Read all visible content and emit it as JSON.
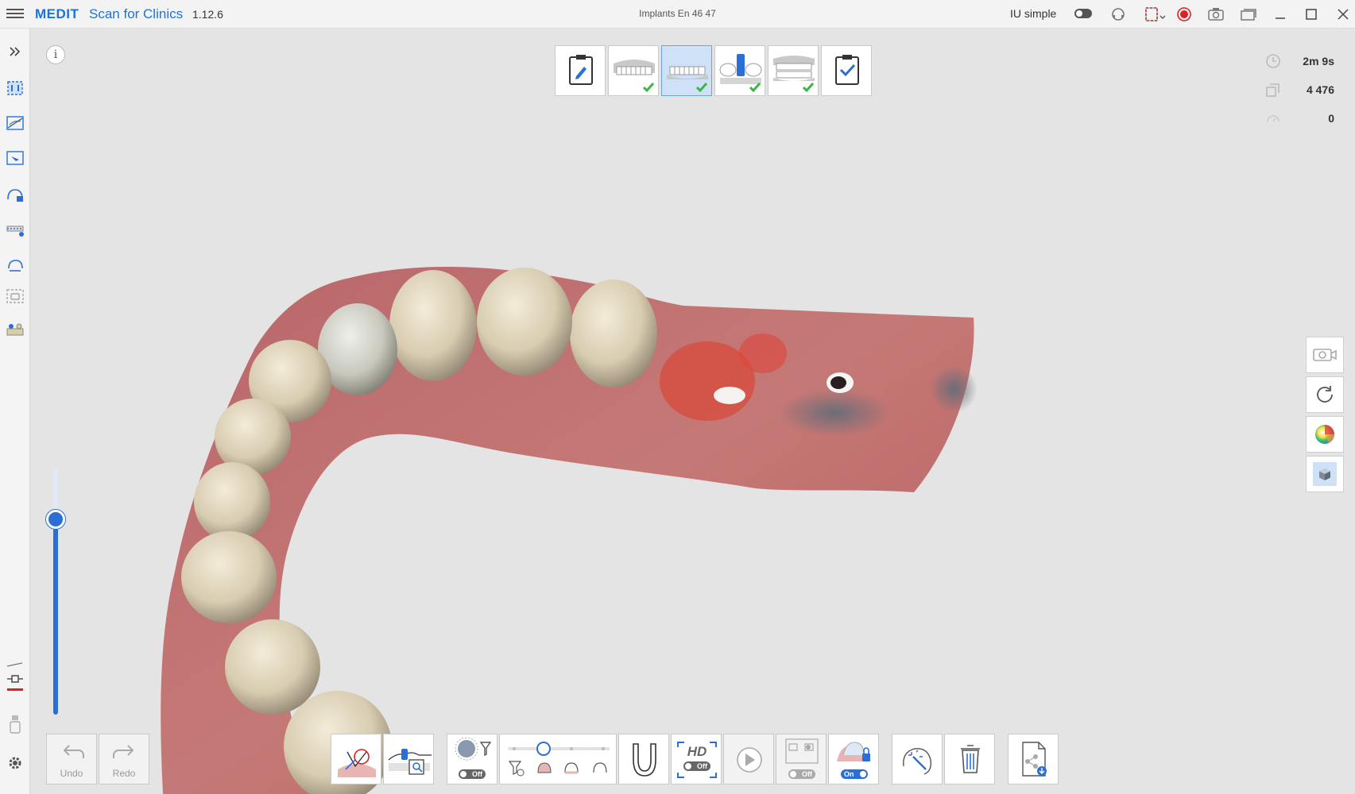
{
  "app": {
    "brand": "MEDIT",
    "name": "Scan for Clinics",
    "version": "1.12.6",
    "document_title": "Implants En 46 47",
    "mode_label": "IU simple"
  },
  "stats": {
    "scan_time": "2m 9s",
    "frame_count": "4 476",
    "third_value": "0"
  },
  "stages": [
    {
      "name": "form",
      "active": false,
      "done": false
    },
    {
      "name": "maxilla",
      "active": false,
      "done": true
    },
    {
      "name": "mandible",
      "active": true,
      "done": true
    },
    {
      "name": "scanbody",
      "active": false,
      "done": true
    },
    {
      "name": "occlusion",
      "active": false,
      "done": true
    },
    {
      "name": "review",
      "active": false,
      "done": false
    }
  ],
  "bottom": {
    "undo_label": "Undo",
    "redo_label": "Redo",
    "filter_toggle": "Off",
    "hd_label": "HD",
    "hd_toggle": "Off",
    "compare_toggle": "Off",
    "lock_toggle": "On"
  },
  "colors": {
    "brand": "#1e73d8",
    "accent": "#2b6fd6",
    "check": "#3bb54a",
    "record": "#e02020"
  },
  "icons": {
    "sidebar": [
      "expand-icon",
      "select-area-icon",
      "lasso-edit-icon",
      "trim-icon",
      "lock-tooth-icon",
      "arch-select-icon",
      "rotate-area-icon",
      "snapshot-area-icon",
      "tooth-library-icon"
    ]
  }
}
